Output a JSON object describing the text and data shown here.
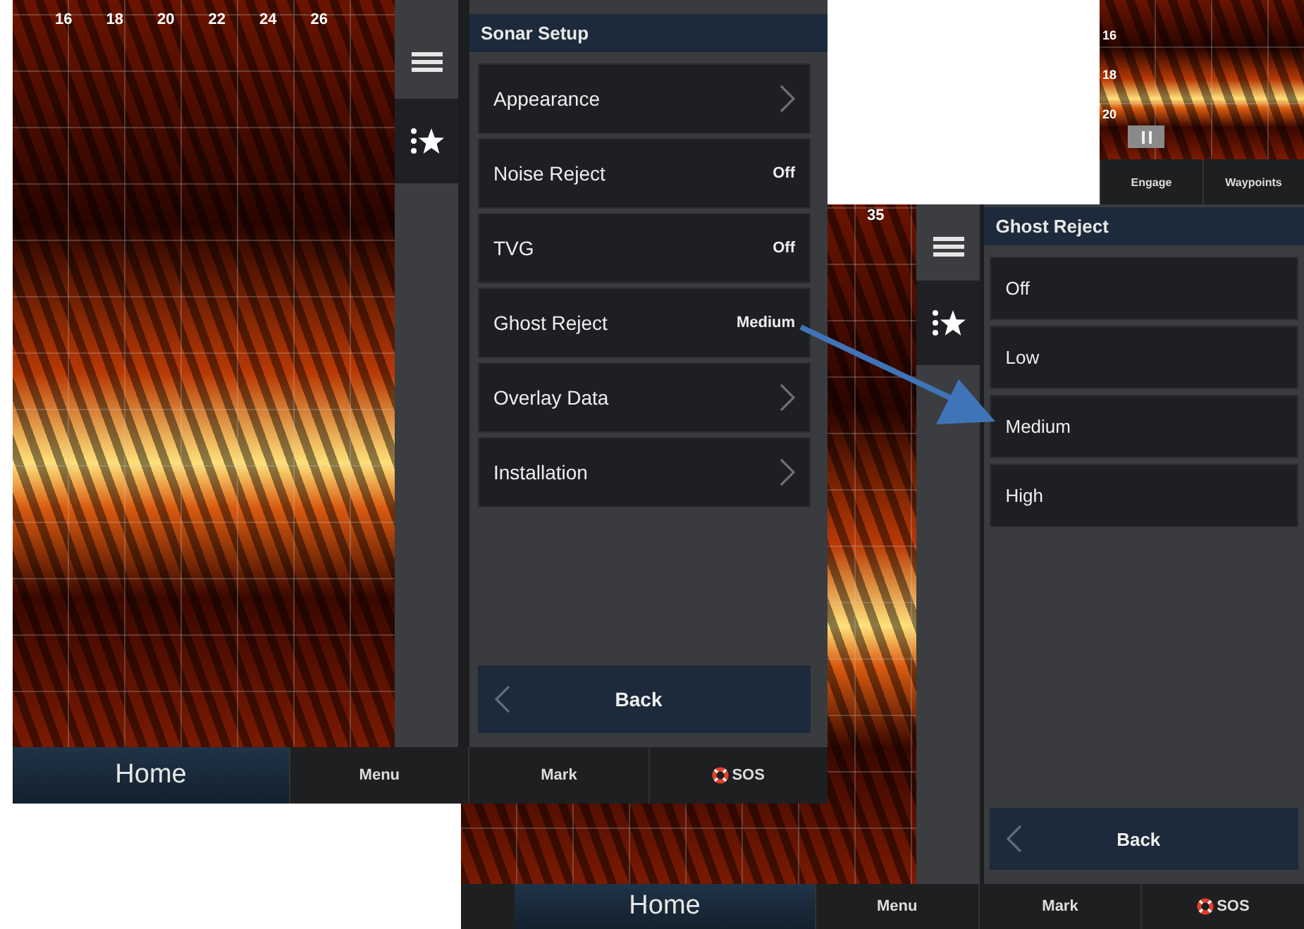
{
  "background_screen": {
    "depth_labels": [
      "16",
      "18",
      "20"
    ],
    "buttons": [
      "Engage",
      "Waypoints"
    ]
  },
  "screens": [
    {
      "scale_labels": [
        "16",
        "18",
        "20",
        "22",
        "24",
        "26"
      ],
      "panel": {
        "title": "Sonar Setup",
        "items": [
          {
            "label": "Appearance",
            "kind": "submenu"
          },
          {
            "label": "Noise Reject",
            "kind": "value",
            "value": "Off"
          },
          {
            "label": "TVG",
            "kind": "value",
            "value": "Off"
          },
          {
            "label": "Ghost Reject",
            "kind": "value",
            "value": "Medium"
          },
          {
            "label": "Overlay Data",
            "kind": "submenu"
          },
          {
            "label": "Installation",
            "kind": "submenu"
          }
        ],
        "back": "Back"
      },
      "nav": {
        "home": "Home",
        "menu": "Menu",
        "mark": "Mark",
        "sos": "SOS"
      }
    },
    {
      "scale_labels": [
        "35"
      ],
      "panel": {
        "title": "Ghost Reject",
        "items": [
          {
            "label": "Off",
            "kind": "option"
          },
          {
            "label": "Low",
            "kind": "option"
          },
          {
            "label": "Medium",
            "kind": "option"
          },
          {
            "label": "High",
            "kind": "option"
          }
        ],
        "back": "Back"
      },
      "nav": {
        "home": "Home",
        "menu": "Menu",
        "mark": "Mark",
        "sos": "SOS"
      }
    }
  ]
}
